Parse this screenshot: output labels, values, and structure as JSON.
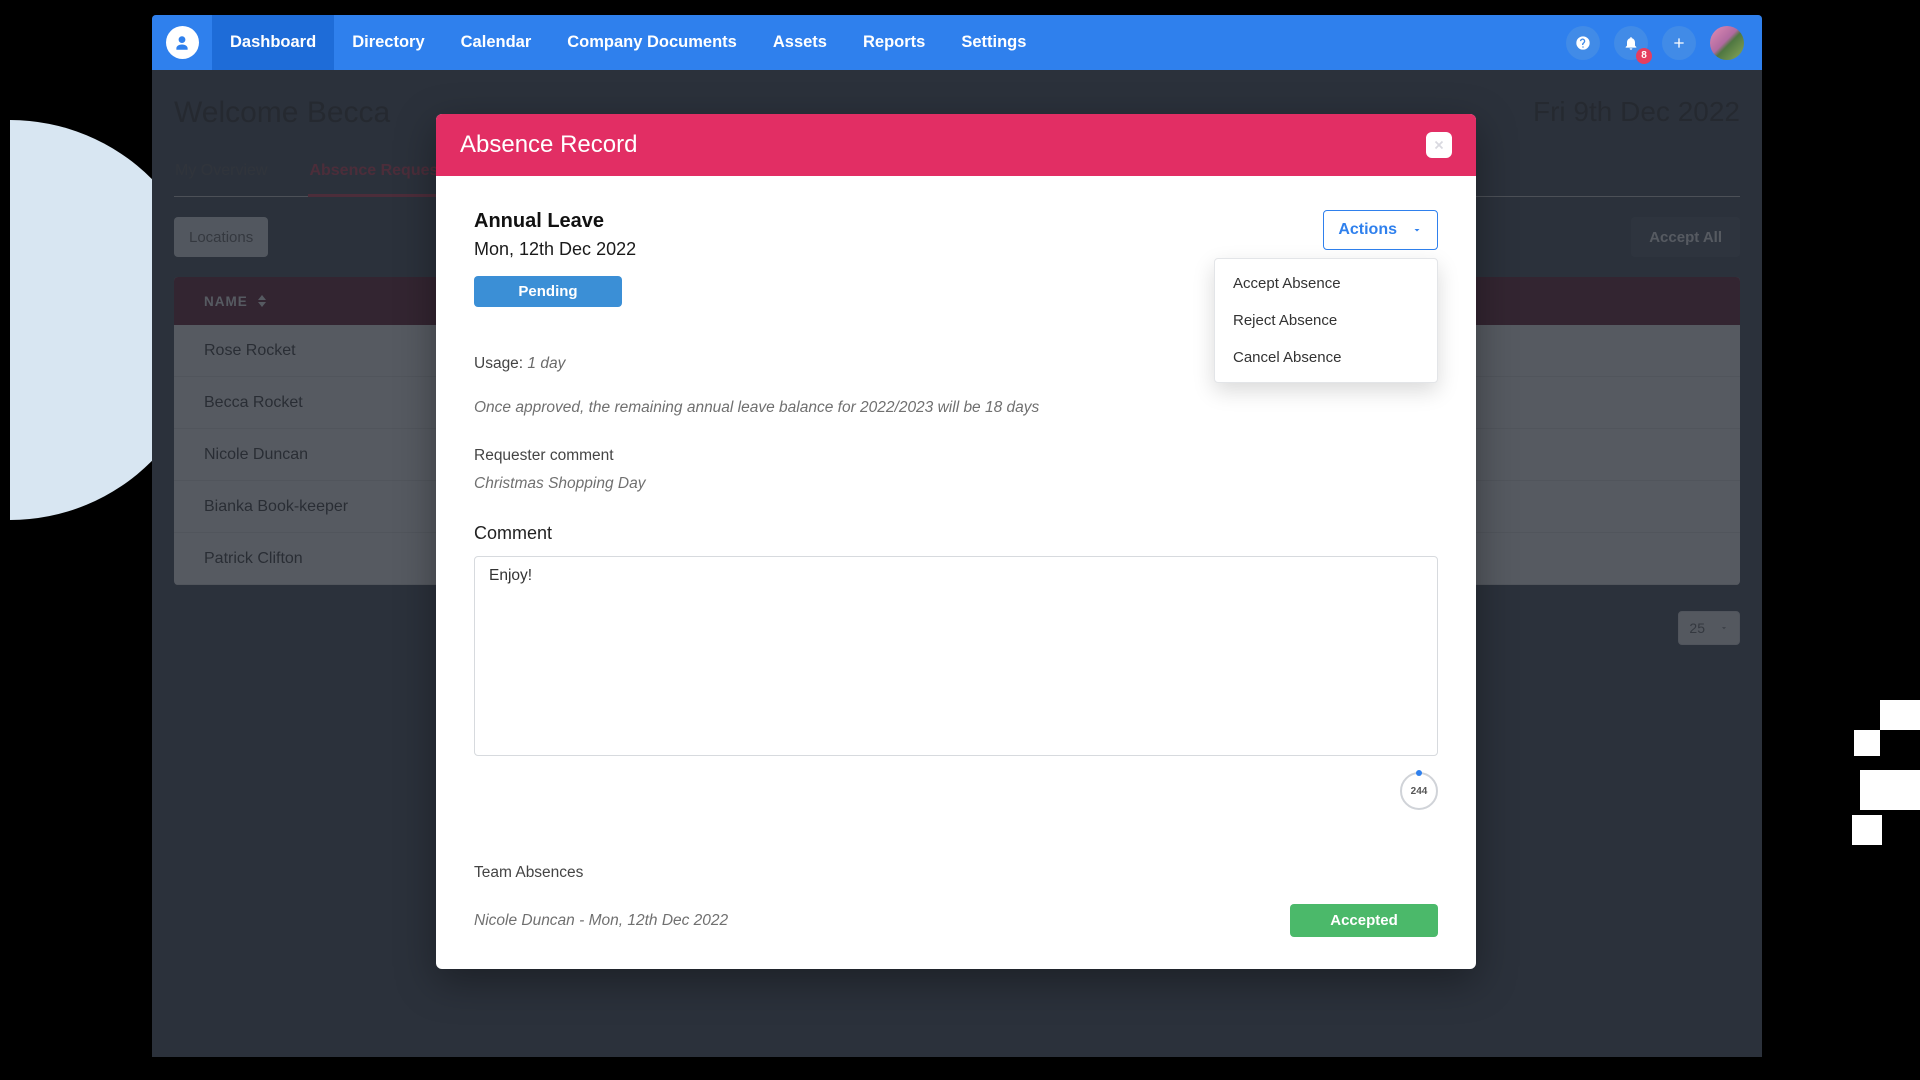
{
  "nav": {
    "items": [
      "Dashboard",
      "Directory",
      "Calendar",
      "Company Documents",
      "Assets",
      "Reports",
      "Settings"
    ],
    "active": "Dashboard",
    "notifications_badge": "8"
  },
  "page": {
    "welcome": "Welcome Becca",
    "date": "Fri 9th Dec 2022",
    "tabs": [
      "My Overview",
      "Absence Requests"
    ],
    "active_tab": "Absence Requests",
    "filter_label": "Locations",
    "accept_all_label": "Accept All",
    "table": {
      "header": "NAME",
      "rows": [
        "Rose Rocket",
        "Becca Rocket",
        "Nicole Duncan",
        "Bianka Book-keeper",
        "Patrick Clifton"
      ]
    },
    "page_size": "25"
  },
  "modal": {
    "title": "Absence Record",
    "record": {
      "type": "Annual Leave",
      "date": "Mon, 12th Dec 2022",
      "status": "Pending"
    },
    "actions": {
      "button": "Actions",
      "items": [
        "Accept Absence",
        "Reject Absence",
        "Cancel Absence"
      ]
    },
    "usage": {
      "label": "Usage: ",
      "value": "1 day"
    },
    "balance_note": "Once approved, the remaining annual leave balance for 2022/2023 will be 18 days",
    "requester_comment": {
      "label": "Requester comment",
      "value": "Christmas Shopping Day"
    },
    "comment": {
      "label": "Comment",
      "value": "Enjoy!"
    },
    "char_remaining": "244",
    "team": {
      "label": "Team Absences",
      "entry": "Nicole Duncan - Mon, 12th Dec 2022",
      "status": "Accepted"
    }
  }
}
